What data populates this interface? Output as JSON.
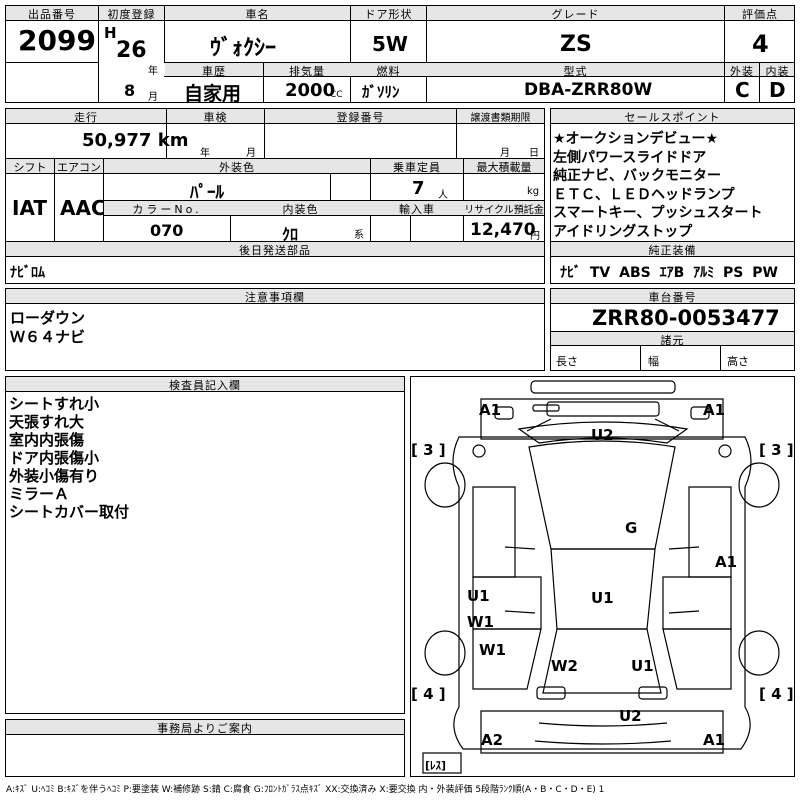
{
  "labels": {
    "lot_no": "出品番号",
    "first_reg": "初度登録",
    "car_name": "車名",
    "door_type": "ドア形状",
    "grade": "グレード",
    "score": "評価点",
    "history": "車歴",
    "displacement": "排気量",
    "fuel": "燃料",
    "model_type": "型式",
    "exterior": "外装",
    "interior": "内装",
    "mileage": "走行",
    "shaken": "車検",
    "reg_no": "登録番号",
    "transfer_deadline": "譲渡書類期限",
    "sales_point": "セールスポイント",
    "shift": "シフト",
    "aircon": "エアコン",
    "ext_color": "外装色",
    "capacity": "乗車定員",
    "max_load": "最大積載量",
    "color_no": "カラーNo.",
    "int_color": "内装色",
    "import": "輸入車",
    "recycle": "リサイクル預託金",
    "later_parts": "後日発送部品",
    "genuine_equip": "純正装備",
    "notes": "注意事項欄",
    "chassis_no": "車台番号",
    "specs": "諸元",
    "length": "長さ",
    "width": "幅",
    "height": "高さ",
    "inspector": "検査員記入欄",
    "office": "事務局よりご案内",
    "year_unit": "年",
    "month_unit": "月",
    "day_unit": "日",
    "cc_unit": "CC",
    "person_unit": "人",
    "kg_unit": "kg",
    "yen_unit": "円",
    "kei_unit": "系",
    "era": "H"
  },
  "values": {
    "lot_no": "2099",
    "year": "26",
    "month": "8",
    "car_name": "ｳﾞｫｸｼｰ",
    "door_type": "5W",
    "grade": "ZS",
    "score": "4",
    "history": "自家用",
    "displacement": "2000",
    "fuel": "ｶﾞｿﾘﾝ",
    "model_type": "DBA-ZRR80W",
    "exterior_grade": "C",
    "interior_grade": "D",
    "mileage": "50,977 km",
    "shift": "IAT",
    "aircon": "AAC",
    "ext_color": "ﾊﾟｰﾙ",
    "capacity": "7",
    "color_no": "070",
    "int_color": "ｸﾛ",
    "recycle": "12,470",
    "later_parts": "ﾅﾋﾞﾛﾑ",
    "genuine_equip": "ﾅﾋﾞ TV ABS ｴｱB ｱﾙﾐ PS PW",
    "chassis_no": "ZRR80-0053477"
  },
  "sales_points": "★オークションデビュー★\n左側パワースライドドア\n純正ナビ、バックモニター\nＥＴＣ、ＬＥＤヘッドランプ\nスマートキー、プッシュスタート\nアイドリングストップ",
  "notes_text": "ローダウン\nＷ６４ナビ",
  "inspector_text": "シートすれ小\n天張すれ大\n室内内張傷\nドア内張傷小\n外装小傷有り\nミラーＡ\nシートカバー取付",
  "diagram": {
    "front_left": "A1",
    "front_right": "A1",
    "windshield": "U2",
    "roof": "G",
    "right_side": "A1",
    "left_upper": "U1",
    "left_upper_2": "W1",
    "center": "U1",
    "left_lower": "W1",
    "rear_center": "W2",
    "rear_right": "U1",
    "rear_glass": "U2",
    "rear_left": "A2",
    "rear_right_corner": "A1",
    "tire_fl": "[ 3 ]",
    "tire_fr": "[ 3 ]",
    "tire_rl": "[ 4 ]",
    "tire_rr": "[ 4 ]",
    "spare": "[ﾚｽ]"
  },
  "legend": "A:ｷｽﾞ U:ﾍｺﾐ B:ｷｽﾞを伴うﾍｺﾐ P:要塗装 W:補修跡 S:錆 C:腐食 G:ﾌﾛﾝﾄｶﾞﾗｽ点ｷｽﾞ XX:交換済み X:要交換 内・外装評価 5段階ﾗﾝｸ順(A・B・C・D・E) 1"
}
